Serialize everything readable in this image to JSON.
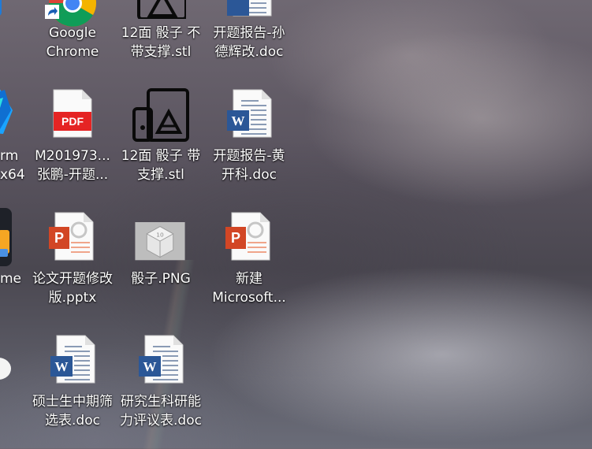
{
  "desktop": {
    "left_column": {
      "item_row2_label": [
        "rm",
        "x64"
      ],
      "item_row3_label": [
        "me"
      ]
    },
    "icons": [
      {
        "id": "google-chrome",
        "lines": [
          "Google",
          "Chrome"
        ]
      },
      {
        "id": "stl-dice-no-support",
        "lines": [
          "12面 骰子 不",
          "带支撑.stl"
        ]
      },
      {
        "id": "doc-report-sun",
        "lines": [
          "开题报告-孙",
          "德辉改.doc"
        ]
      },
      {
        "id": "pdf-m201973",
        "lines": [
          "M201973...",
          "张鹏-开题..."
        ],
        "badge": "PDF"
      },
      {
        "id": "stl-dice-support",
        "lines": [
          "12面 骰子 带",
          "支撑.stl"
        ]
      },
      {
        "id": "doc-report-huang",
        "lines": [
          "开题报告-黄",
          "开科.doc"
        ]
      },
      {
        "id": "pptx-thesis",
        "lines": [
          "论文开题修改",
          "版.pptx"
        ],
        "badge": "P"
      },
      {
        "id": "png-dice",
        "lines": [
          "骰子.PNG"
        ]
      },
      {
        "id": "pptx-new",
        "lines": [
          "新建",
          "Microsoft..."
        ],
        "badge": "P"
      },
      {
        "id": "doc-midterm",
        "lines": [
          "硕士生中期筛",
          "选表.doc"
        ],
        "badge": "W"
      },
      {
        "id": "doc-evaluation",
        "lines": [
          "研究生科研能",
          "力评议表.doc"
        ],
        "badge": "W"
      }
    ]
  }
}
